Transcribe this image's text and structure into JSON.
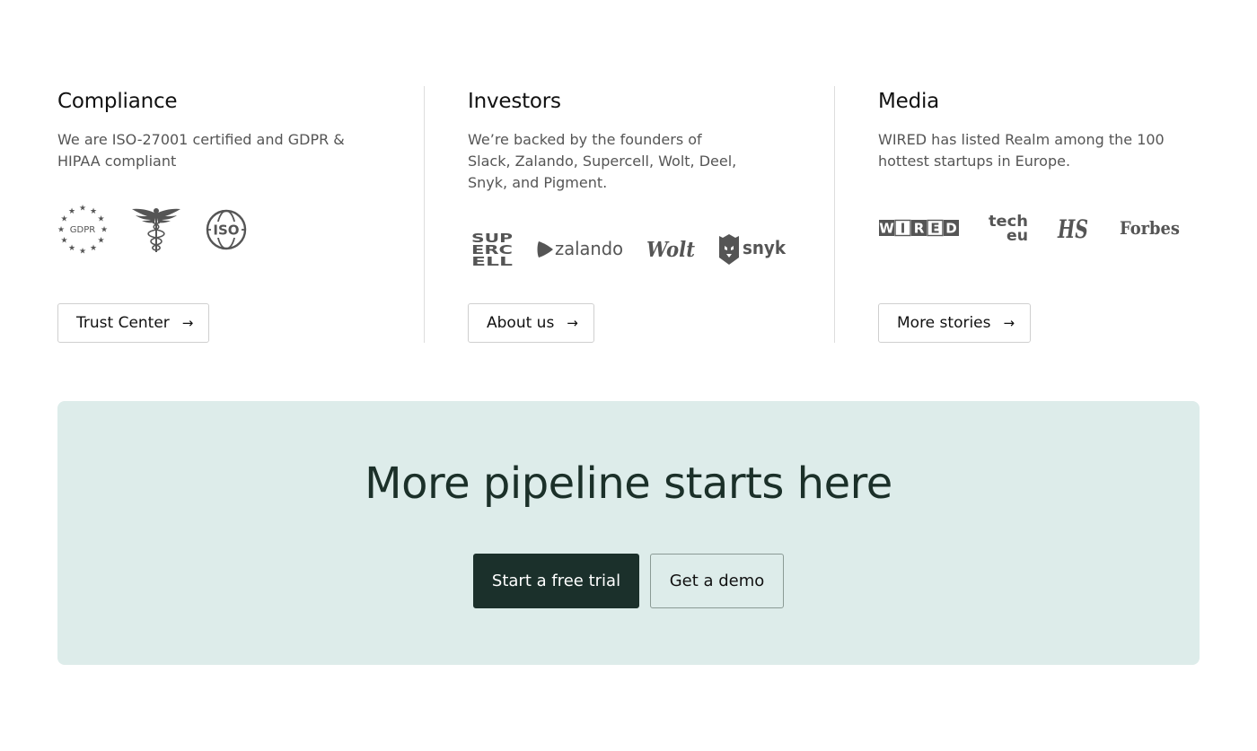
{
  "columns": [
    {
      "title": "Compliance",
      "description": "We are ISO-27001 certified and GDPR & HIPAA compliant",
      "logos": [
        {
          "icon": "gdpr-icon",
          "text": "GDPR"
        },
        {
          "icon": "caduceus-icon"
        },
        {
          "icon": "iso-icon",
          "text": "ISO"
        }
      ],
      "button": "Trust Center"
    },
    {
      "title": "Investors",
      "description": "We’re backed by the founders of Slack, Zalando, Supercell, Wolt, Deel, Snyk, and Pigment.",
      "logos": [
        {
          "icon": "supercell-logo",
          "lines": [
            "SUP",
            "ERC",
            "ELL"
          ]
        },
        {
          "icon": "zalando-logo",
          "text": "zalando"
        },
        {
          "icon": "wolt-logo",
          "text": "Wolt"
        },
        {
          "icon": "snyk-logo",
          "text": "snyk"
        }
      ],
      "button": "About us"
    },
    {
      "title": "Media",
      "description": "WIRED has listed Realm among the 100 hottest startups in Europe.",
      "logos": [
        {
          "icon": "wired-logo",
          "letters": [
            "W",
            "I",
            "R",
            "E",
            "D"
          ]
        },
        {
          "icon": "techeu-logo",
          "lines": [
            "tech",
            "eu"
          ]
        },
        {
          "icon": "hs-logo",
          "text": "HS"
        },
        {
          "icon": "forbes-logo",
          "text": "Forbes"
        }
      ],
      "button": "More stories"
    }
  ],
  "cta": {
    "title": "More pipeline starts here",
    "primary_button": "Start a free trial",
    "secondary_button": "Get a demo"
  },
  "colors": {
    "cta_background": "#ddecea",
    "primary_button": "#1b302b",
    "heading_dark": "#1b3029",
    "logo_gray": "#555555"
  }
}
